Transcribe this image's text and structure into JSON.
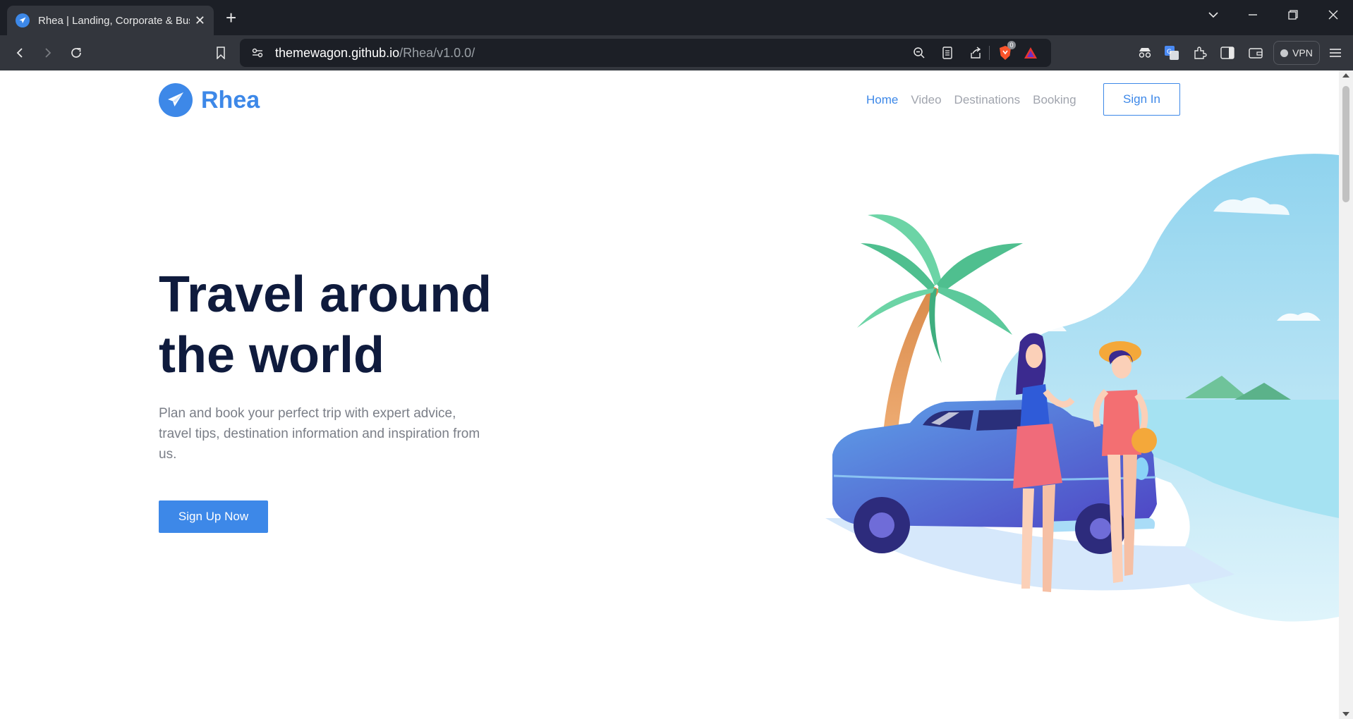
{
  "browser": {
    "tab_title": "Rhea | Landing, Corporate & Business Template",
    "url_host": "themewagon.github.io",
    "url_path": "/Rhea/v1.0.0/",
    "vpn_label": "VPN",
    "brave_badge": "0"
  },
  "brand": {
    "name": "Rhea"
  },
  "nav": {
    "items": [
      "Home",
      "Video",
      "Destinations",
      "Booking"
    ],
    "active": "Home",
    "signin_label": "Sign In"
  },
  "hero": {
    "title_line1": "Travel around",
    "title_line2": "the world",
    "text": "Plan and book your perfect trip with expert advice, travel tips, destination information and inspiration from us.",
    "cta_label": "Sign Up Now"
  },
  "colors": {
    "accent": "#3d88e8",
    "heading": "#0f1b3d",
    "body_text": "#7a7e87",
    "chrome_dark": "#1c1f26",
    "chrome_bar": "#33363d"
  }
}
